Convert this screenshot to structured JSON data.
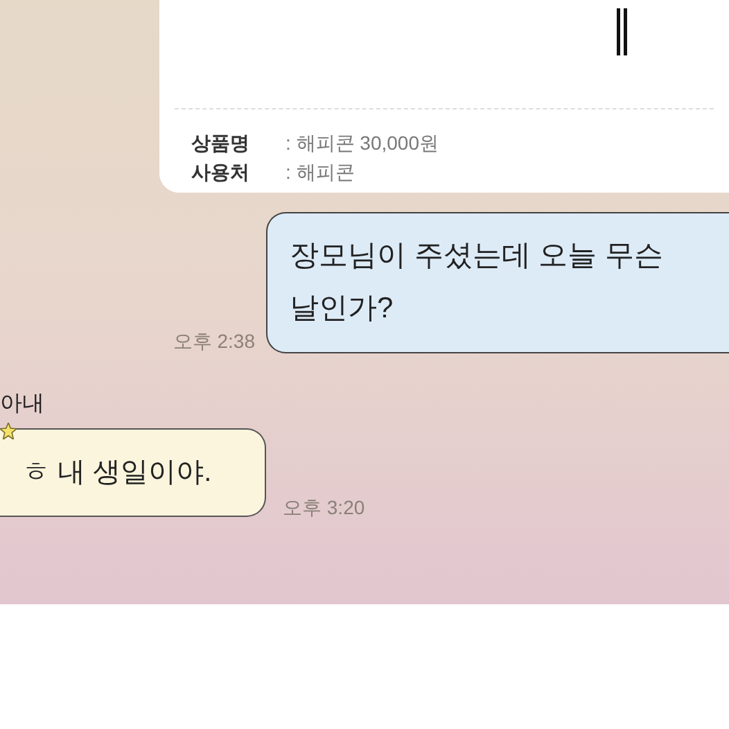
{
  "gift_card": {
    "fields": [
      {
        "label": "상품명",
        "value": ": 해피콘 30,000원"
      },
      {
        "label": "사용처",
        "value": ": 해피콘"
      }
    ]
  },
  "messages": [
    {
      "kind": "sent",
      "text": "장모님이 주셨는데 오늘 무슨 날인가?",
      "time": "오후 2:38"
    },
    {
      "kind": "received",
      "sender": "아내",
      "text": "ㅎ 내 생일이야.",
      "time": "오후 3:20"
    }
  ]
}
